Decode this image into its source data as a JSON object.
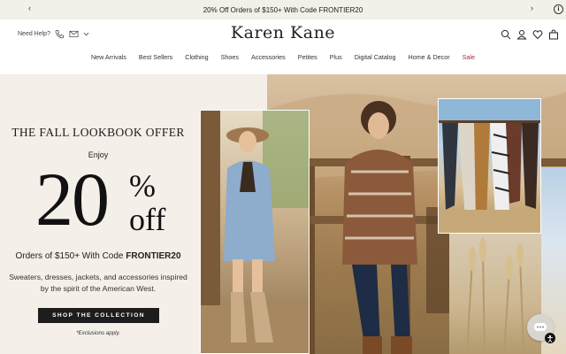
{
  "announcement": {
    "text": "20% Off Orders of $150+ With Code FRONTIER20"
  },
  "header": {
    "help_label": "Need Help?",
    "logo": "Karen Kane"
  },
  "nav": {
    "items": [
      "New Arrivals",
      "Best Sellers",
      "Clothing",
      "Shoes",
      "Accessories",
      "Petites",
      "Plus",
      "Digital Catalog",
      "Home & Decor",
      "Sale"
    ]
  },
  "hero": {
    "kicker": "THE FALL LOOKBOOK OFFER",
    "enjoy": "Enjoy",
    "big_number": "20",
    "percent": "%",
    "off": "off",
    "orders_prefix": "Orders of $150+ With Code ",
    "orders_code": "FRONTIER20",
    "description": "Sweaters, dresses, jackets, and accessories inspired by the spirit of the American West.",
    "cta": "SHOP THE COLLECTION",
    "exclusions": "*Exclusions apply."
  },
  "colors": {
    "announce_bg": "#f3efe9",
    "hero_bg": "#f4efe8",
    "sale": "#b0263a",
    "cta_bg": "#1d1d1d"
  }
}
